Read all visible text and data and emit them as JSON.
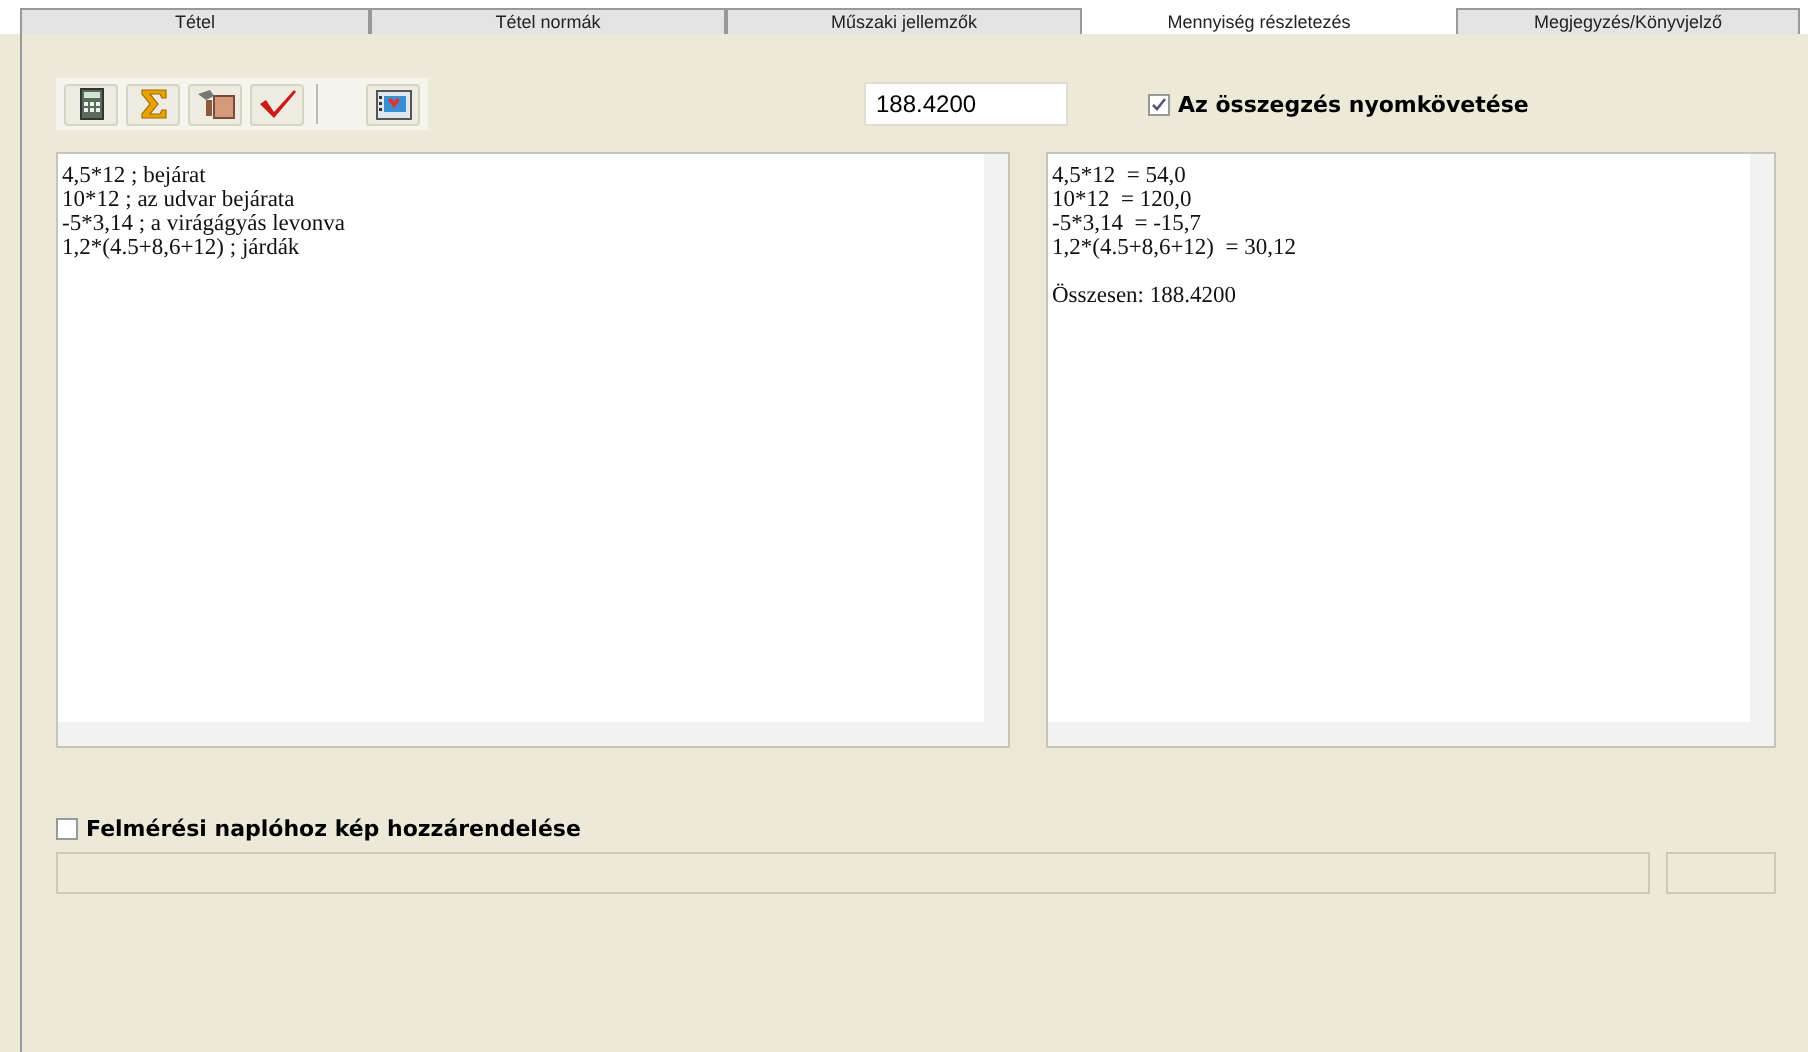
{
  "tabs": [
    {
      "label": "Tétel",
      "selected": false
    },
    {
      "label": "Tétel normák",
      "selected": false
    },
    {
      "label": "Műszaki jellemzők",
      "selected": false
    },
    {
      "label": "Mennyiség részletezés",
      "selected": true
    },
    {
      "label": "Megjegyzés/Könyvjelző",
      "selected": false
    }
  ],
  "total_field": {
    "value": "188.4200"
  },
  "track_sum": {
    "label": "Az összegzés nyomkövetése",
    "checked": true
  },
  "input_lines": [
    "4,5*12 ; bejárat",
    "10*12 ; az udvar bejárata",
    "-5*3,14 ; a virágágyás levonva",
    "1,2*(4.5+8,6+12) ; járdák"
  ],
  "result_lines": [
    "4,5*12  = 54,0",
    "10*12  = 120,0",
    "-5*3,14  = -15,7",
    "1,2*(4.5+8,6+12)  = 30,12"
  ],
  "result_total": "Összesen: 188.4200",
  "attach_image": {
    "label": "Felmérési naplóhoz kép hozzárendelése",
    "checked": false
  }
}
